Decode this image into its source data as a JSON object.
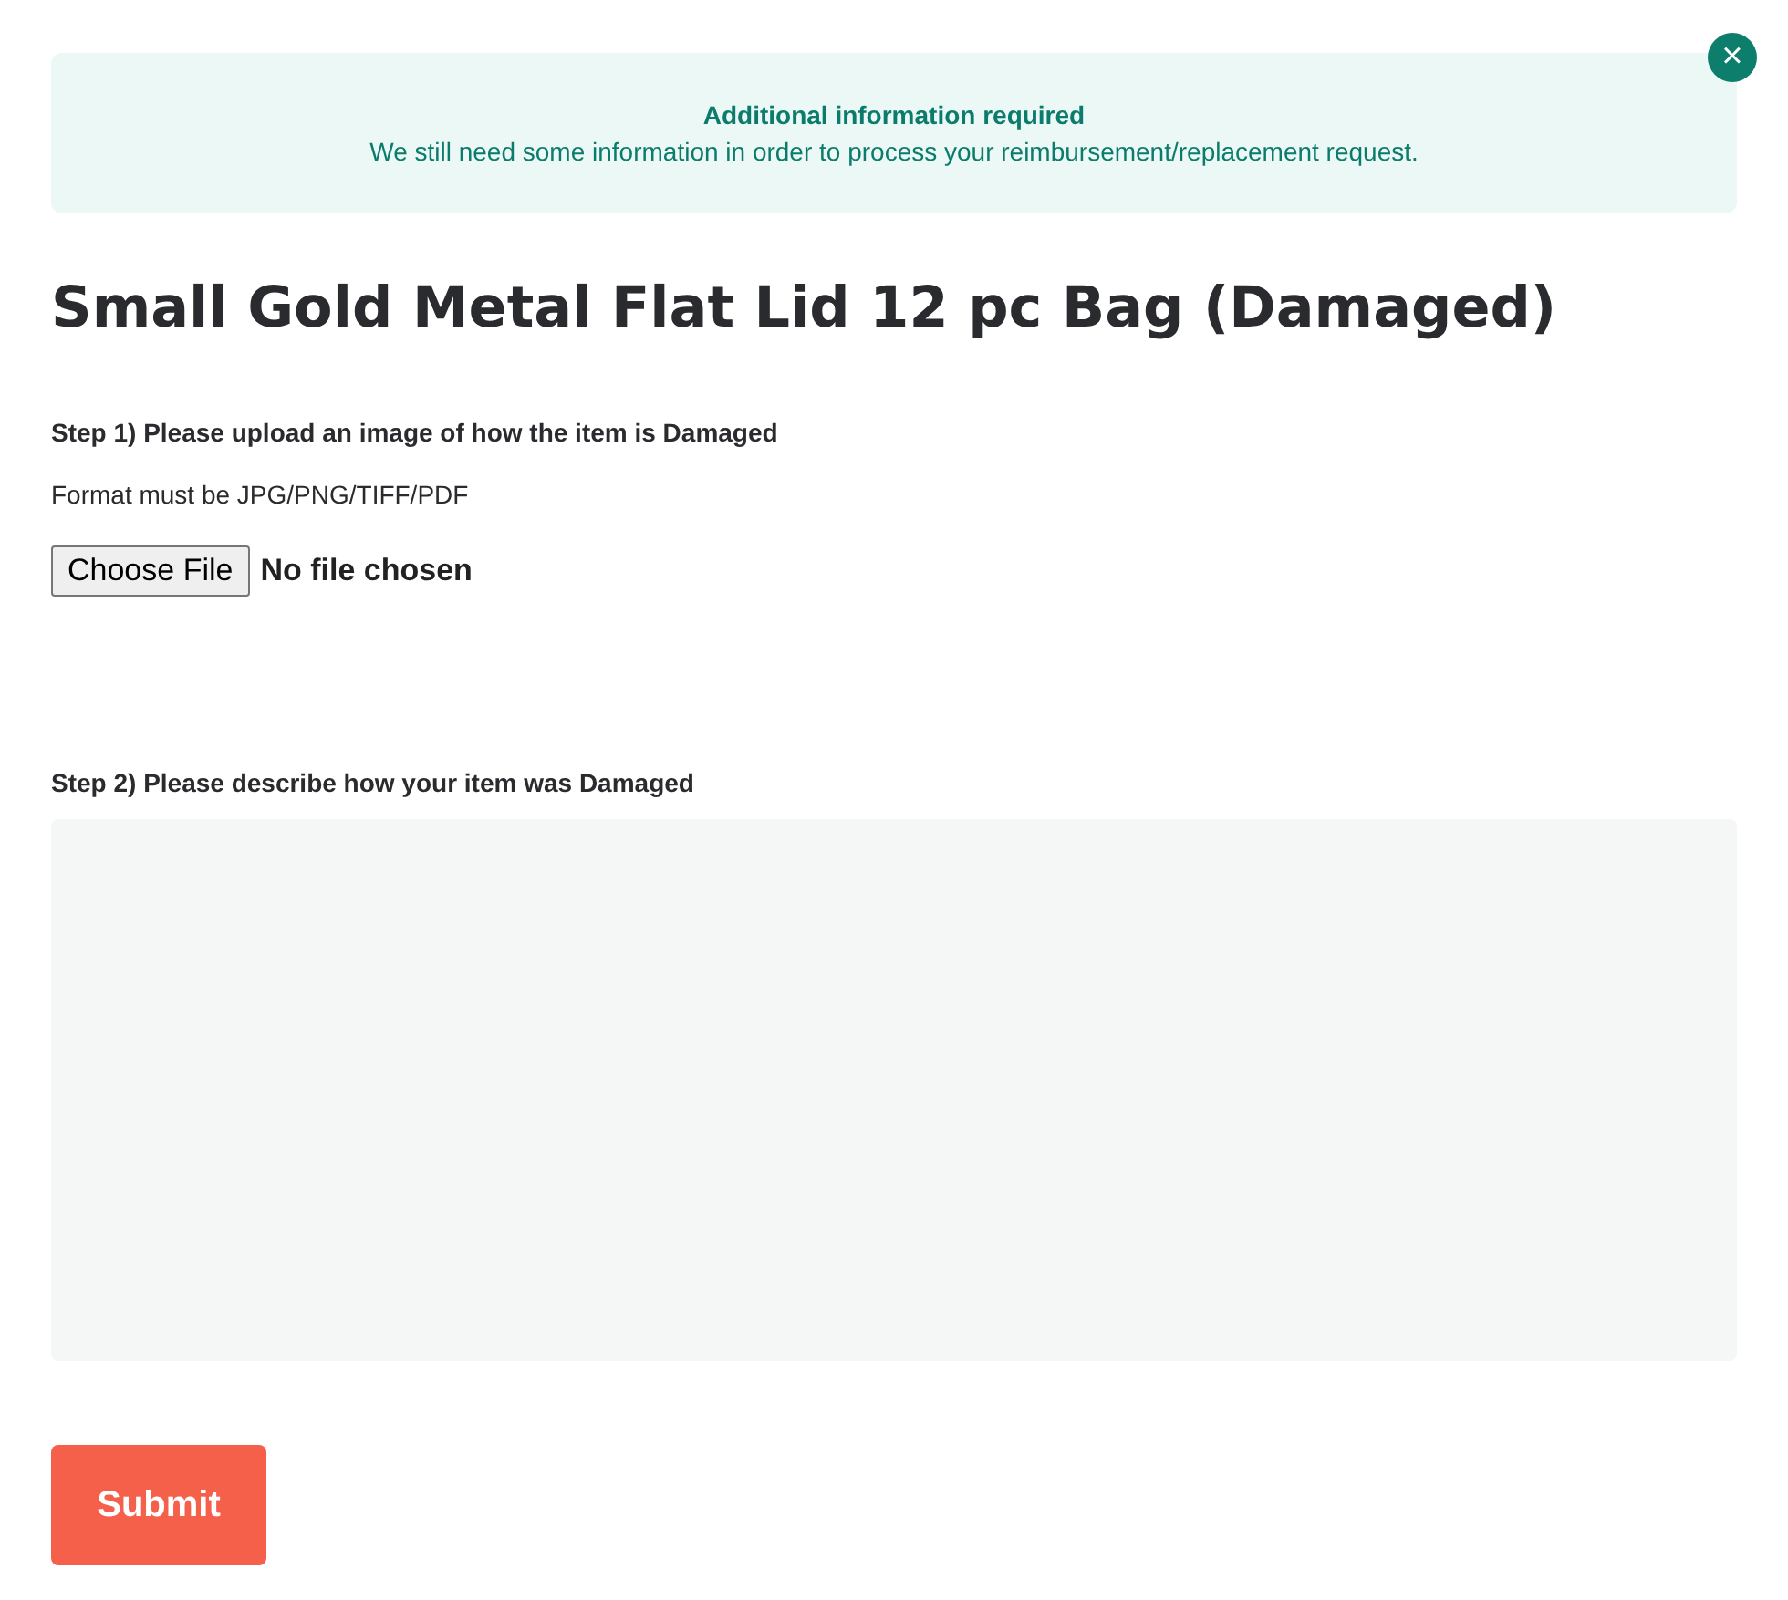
{
  "notice": {
    "title": "Additional information required",
    "message": "We still need some information in order to process your reimbursement/replacement request."
  },
  "close_button": {
    "icon": "×"
  },
  "title": "Small Gold Metal Flat Lid 12 pc Bag (Damaged)",
  "step_1": {
    "label": "Step 1) Please upload an image of how the item is Damaged",
    "hint": "Format must be JPG/PNG/TIFF/PDF",
    "file_button": "Choose File",
    "file_status": "No file chosen"
  },
  "step_2": {
    "label": "Step 2) Please describe how your item was Damaged"
  },
  "submit": "Submit"
}
